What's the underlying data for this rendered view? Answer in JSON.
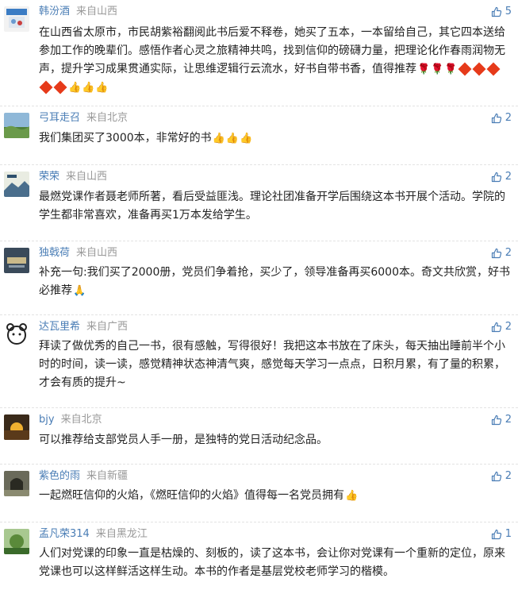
{
  "comments": [
    {
      "user": "韩汾酒",
      "location": "来自山西",
      "likes": "5",
      "text": "在山西省太原市，市民胡紫裕翻阅此书后爱不释卷，她买了五本，一本留给自己，其它四本送给参加工作的晚辈们。感悟作者心灵之旅精神共鸣，找到信仰的磅礴力量，把理论化作春雨润物无声，提升学习成果贯通实际，让思维逻辑行云流水，好书自带书香，值得推荐",
      "emoji": [
        "rose",
        "rose",
        "rose",
        "fu",
        "fu",
        "fu",
        "fu",
        "fu",
        "thumbs",
        "thumbs",
        "thumbs"
      ]
    },
    {
      "user": "弓耳走召",
      "location": "来自北京",
      "likes": "2",
      "text": "我们集团买了3000本，非常好的书",
      "emoji": [
        "thumbs",
        "thumbs",
        "thumbs"
      ]
    },
    {
      "user": "荣荣",
      "location": "来自山西",
      "likes": "2",
      "text": "最燃党课作者聂老师所著，看后受益匪浅。理论社团准备开学后围绕这本书开展个活动。学院的学生都非常喜欢，准备再买1万本发给学生。",
      "emoji": []
    },
    {
      "user": "独戟荷",
      "location": "来自山西",
      "likes": "2",
      "text": "补充一句:我们买了2000册，党员们争着抢，买少了，领导准备再买6000本。奇文共欣赏，好书必推荐",
      "emoji": [
        "bow"
      ]
    },
    {
      "user": "达瓦里希",
      "location": "来自广西",
      "likes": "2",
      "text": "拜读了做优秀的自己一书，很有感触，写得很好！我把这本书放在了床头，每天抽出睡前半个小时的时间，读一读，感觉精神状态神清气爽，感觉每天学习一点点，日积月累，有了量的积累，才会有质的提升~",
      "emoji": []
    },
    {
      "user": "bjy",
      "location": "来自北京",
      "likes": "2",
      "text": "可以推荐给支部党员人手一册，是独特的党日活动纪念品。",
      "emoji": []
    },
    {
      "user": "紫色的雨",
      "location": "来自新疆",
      "likes": "2",
      "text": "一起燃旺信仰的火焰，《燃旺信仰的火焰》值得每一名党员拥有",
      "emoji": [
        "thumbs"
      ]
    },
    {
      "user": "孟凡荣314",
      "location": "来自黑龙江",
      "likes": "1",
      "text": "人们对党课的印象一直是枯燥的、刻板的，读了这本书，会让你对党课有一个重新的定位，原来党课也可以这样鲜活这样生动。本书的作者是基层党校老师学习的楷模。",
      "emoji": []
    }
  ],
  "colors": {
    "username": "#4a7db5",
    "location": "#999999",
    "like": "#4a7db5"
  },
  "icons": {
    "like": "thumbs-up-outline-icon"
  }
}
